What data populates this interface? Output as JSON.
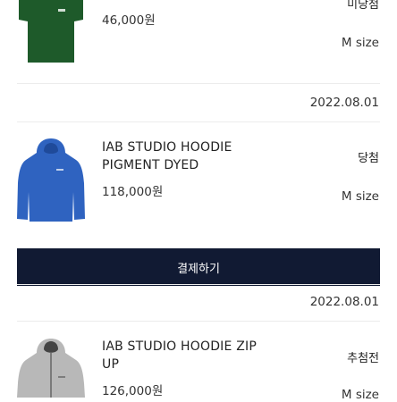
{
  "orders": [
    {
      "product_name": "",
      "price": "46,000원",
      "status": "미당첨",
      "size": "M size",
      "color": "#1e5a2a",
      "image_icon": "green-tshirt"
    },
    {
      "date": "2022.08.01",
      "product_name": "IAB STUDIO HOODIE PIGMENT DYED",
      "price": "118,000원",
      "status": "당첨",
      "size": "M size",
      "color": "#2f63c0",
      "image_icon": "blue-hoodie",
      "pay_button": "결제하기"
    },
    {
      "date": "2022.08.01",
      "product_name": "IAB STUDIO HOODIE ZIP UP",
      "price": "126,000원",
      "status": "추첨전",
      "size": "M size",
      "color": "#b8b8b8",
      "image_icon": "gray-zip-hoodie"
    }
  ]
}
